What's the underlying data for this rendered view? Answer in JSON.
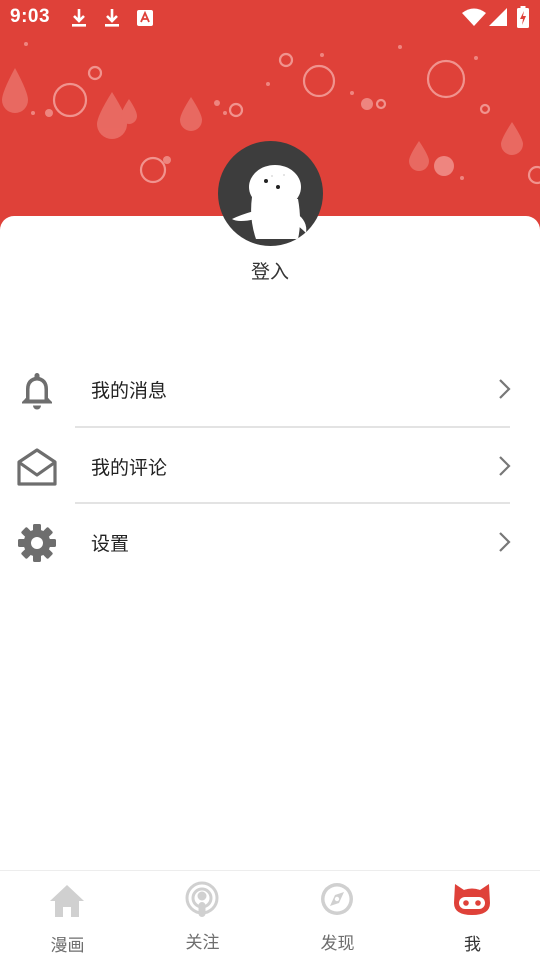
{
  "status_bar": {
    "time": "9:03"
  },
  "profile": {
    "login_label": "登入"
  },
  "menu": {
    "items": [
      {
        "label": "我的消息",
        "icon": "bell-icon"
      },
      {
        "label": "我的评论",
        "icon": "envelope-open-icon"
      },
      {
        "label": "设置",
        "icon": "gear-icon"
      }
    ]
  },
  "bottom_nav": {
    "items": [
      {
        "label": "漫画",
        "icon": "home-icon",
        "active": false
      },
      {
        "label": "关注",
        "icon": "podcast-icon",
        "active": false
      },
      {
        "label": "发现",
        "icon": "compass-icon",
        "active": false
      },
      {
        "label": "我",
        "icon": "cat-face-icon",
        "active": true
      }
    ]
  },
  "colors": {
    "header_red": "#df4139",
    "icon_gray": "#6e6e6e",
    "nav_inactive": "#d0d0d0",
    "nav_active": "#df4139"
  }
}
